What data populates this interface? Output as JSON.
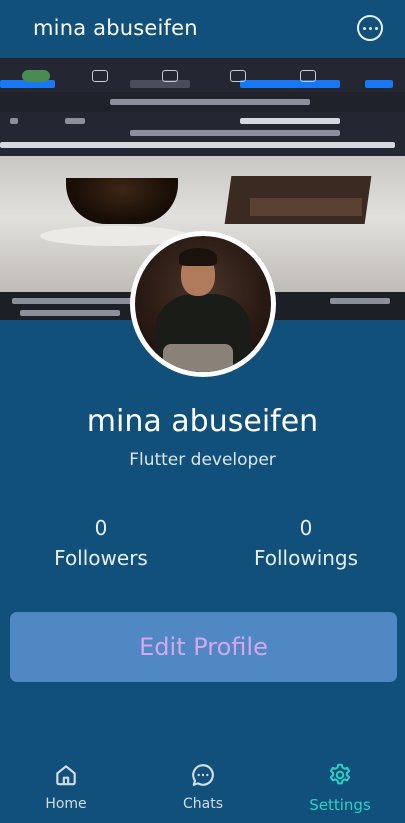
{
  "appbar": {
    "title": "mina abuseifen",
    "more_icon": "more-horizontal-circle-icon"
  },
  "profile": {
    "name": "mina abuseifen",
    "bio": "Flutter developer"
  },
  "stats": [
    {
      "value": "0",
      "label": "Followers"
    },
    {
      "value": "0",
      "label": "Followings"
    }
  ],
  "edit_button": {
    "label": "Edit Profile"
  },
  "nav": {
    "items": [
      {
        "label": "Home",
        "icon": "home-icon"
      },
      {
        "label": "Chats",
        "icon": "chat-bubble-icon"
      },
      {
        "label": "Settings",
        "icon": "gear-icon"
      }
    ],
    "active": "Settings",
    "active_color": "#29d3c8"
  },
  "colors": {
    "background": "#10507a",
    "button": "#4f88c2",
    "button_text": "#d3a8f0"
  }
}
